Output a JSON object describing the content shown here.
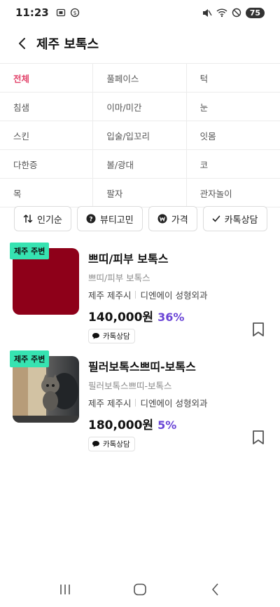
{
  "status": {
    "time": "11:23",
    "battery": "75"
  },
  "header": {
    "title": "제주 보톡스",
    "back_icon": "chevron-left-icon"
  },
  "categories": [
    [
      "전체",
      "풀페이스",
      "턱"
    ],
    [
      "침샘",
      "이마/미간",
      "눈"
    ],
    [
      "스킨",
      "입술/입꼬리",
      "잇몸"
    ],
    [
      "다한증",
      "볼/광대",
      "코"
    ],
    [
      "목",
      "팔자",
      "관자놀이"
    ]
  ],
  "filters": [
    {
      "label": "인기순",
      "icon": "sort-arrows-icon"
    },
    {
      "label": "뷰티고민",
      "icon": "question-circle-icon"
    },
    {
      "label": "가격",
      "icon": "won-circle-icon"
    },
    {
      "label": "카톡상담",
      "icon": "check-icon"
    }
  ],
  "products": [
    {
      "badge": "제주 주변",
      "title": "쁘띠/피부 보톡스",
      "subtitle": "쁘띠/피부 보톡스",
      "region": "제주 제주시",
      "clinic": "디엔에이 성형외과",
      "price": "140,000원",
      "discount": "36%",
      "tag": "카톡상담",
      "thumb_color": "#8e0019"
    },
    {
      "badge": "제주 주변",
      "title": "필러보톡스쁘띠-보톡스",
      "subtitle": "필러보톡스쁘띠-보톡스",
      "region": "제주 제주시",
      "clinic": "디엔에이 성형외과",
      "price": "180,000원",
      "discount": "5%",
      "tag": "카톡상담"
    }
  ],
  "colors": {
    "accent": "#e2446b",
    "discount": "#6a45d6",
    "badge": "#36e3b1"
  }
}
